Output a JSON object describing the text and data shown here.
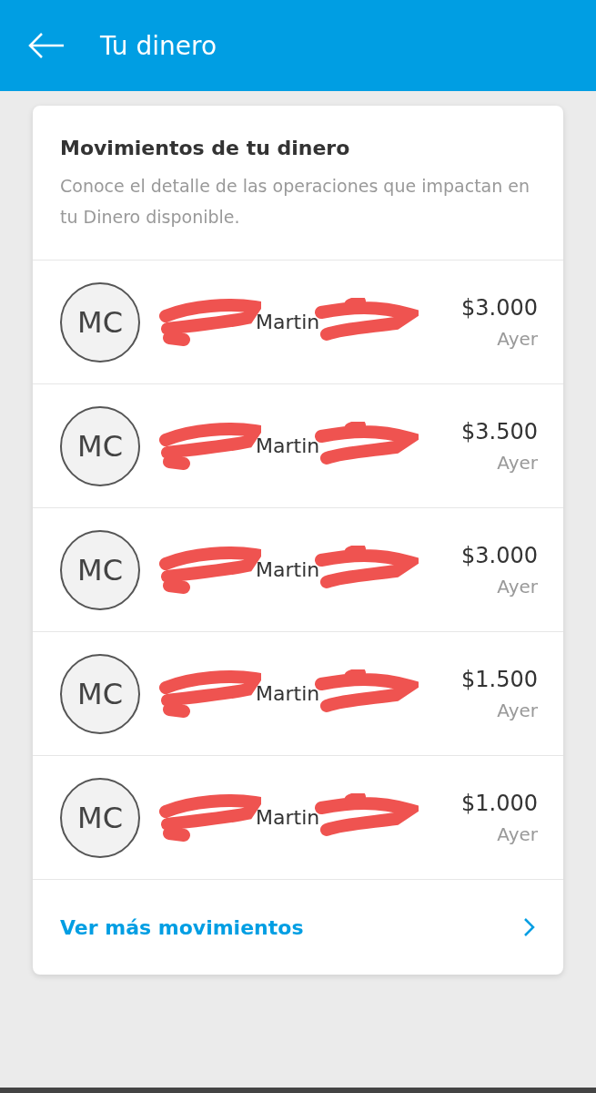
{
  "app_bar": {
    "title": "Tu dinero"
  },
  "card": {
    "title": "Movimientos de tu dinero",
    "description": "Conoce el detalle de las operaciones que impactan en tu Dinero disponible.",
    "movements": [
      {
        "initials": "MC",
        "name": "Martin",
        "amount": "$3.000",
        "date": "Ayer"
      },
      {
        "initials": "MC",
        "name": "Martin",
        "amount": "$3.500",
        "date": "Ayer"
      },
      {
        "initials": "MC",
        "name": "Martin",
        "amount": "$3.000",
        "date": "Ayer"
      },
      {
        "initials": "MC",
        "name": "Martin",
        "amount": "$1.500",
        "date": "Ayer"
      },
      {
        "initials": "MC",
        "name": "Martin",
        "amount": "$1.000",
        "date": "Ayer"
      }
    ],
    "more_link": "Ver más movimientos"
  }
}
